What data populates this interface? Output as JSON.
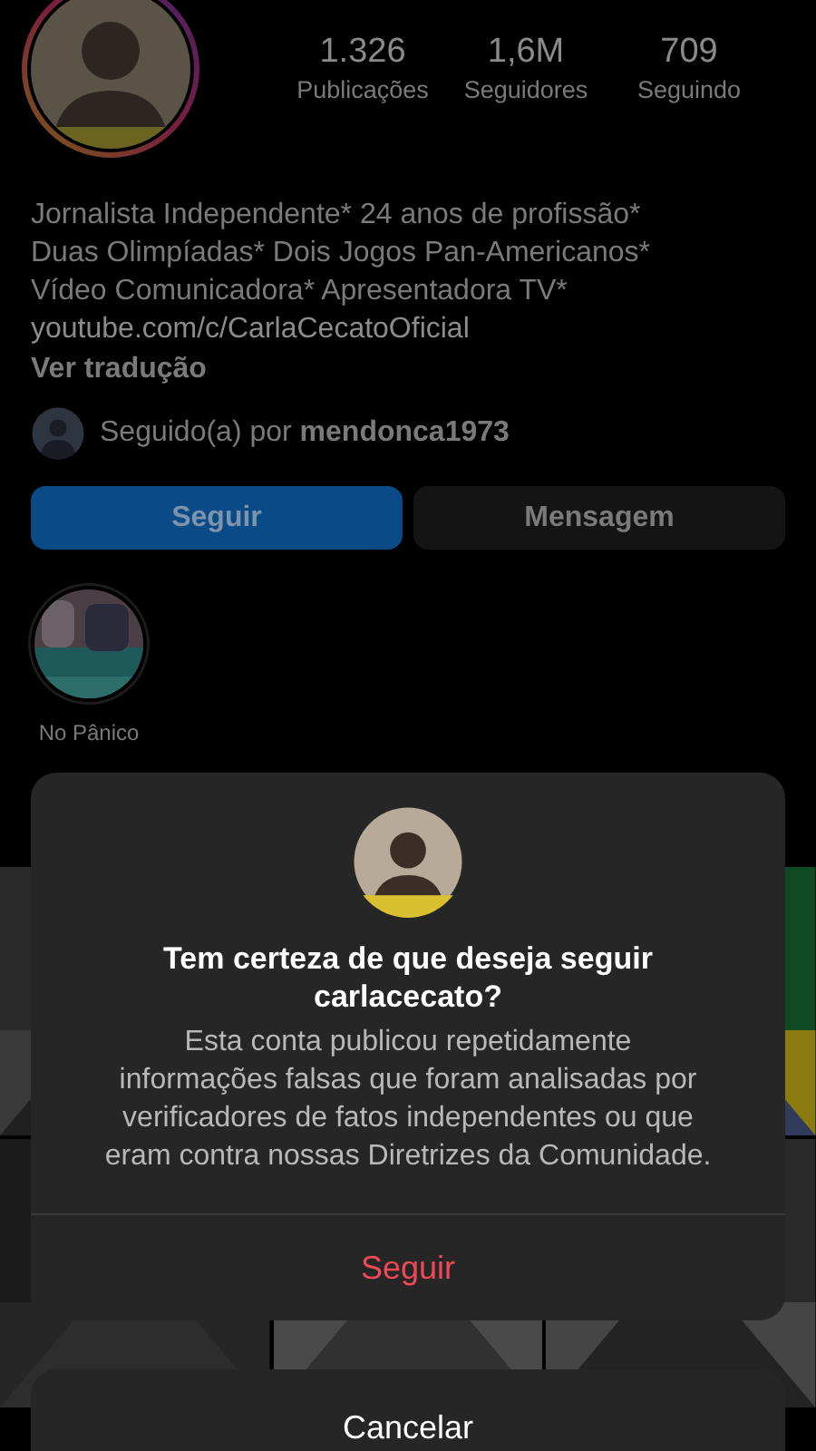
{
  "profile": {
    "stats": [
      {
        "value": "1.326",
        "label": "Publicações"
      },
      {
        "value": "1,6M",
        "label": "Seguidores"
      },
      {
        "value": "709",
        "label": "Seguindo"
      }
    ],
    "bio": [
      {
        "kind": "text",
        "text": "Jornalista Independente* 24 anos de profissão*"
      },
      {
        "kind": "text",
        "text": "Duas Olimpíadas* Dois Jogos Pan-Americanos*"
      },
      {
        "kind": "text",
        "text": "Vídeo Comunicadora* Apresentadora TV*"
      },
      {
        "kind": "link",
        "text": "youtube.com/c/CarlaCecatoOficial"
      }
    ],
    "translate": "Ver tradução",
    "followed_by": "Seguido(a) por **mendonca1973**",
    "buttons": [
      {
        "label": "Seguir",
        "kind": "primary"
      },
      {
        "label": "Mensagem",
        "kind": "secondary"
      }
    ],
    "highlights": [
      {
        "label": "No Pânico"
      }
    ]
  },
  "dialog": {
    "title": "Tem certeza de que deseja seguir carlacecato?",
    "message": "Esta conta publicou repetidamente informações falsas que foram analisadas por verificadores de fatos independentes ou que eram contra nossas Diretrizes da Comunidade.",
    "confirm": "Seguir",
    "cancel": "Cancelar"
  }
}
